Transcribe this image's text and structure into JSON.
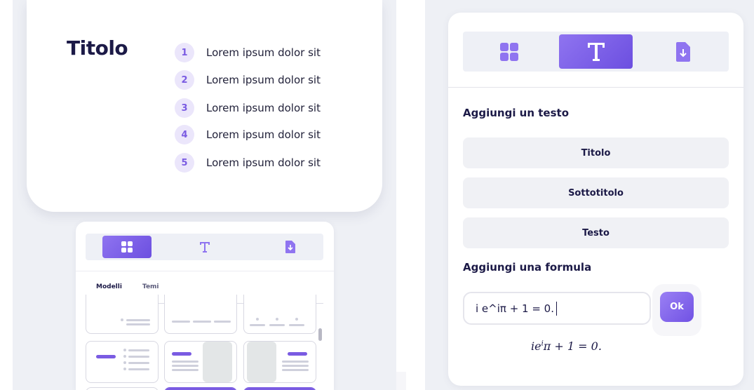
{
  "slide": {
    "title": "Titolo",
    "items": [
      {
        "num": "1",
        "text": "Lorem ipsum dolor sit"
      },
      {
        "num": "2",
        "text": "Lorem ipsum dolor sit"
      },
      {
        "num": "3",
        "text": "Lorem ipsum dolor sit"
      },
      {
        "num": "4",
        "text": "Lorem ipsum dolor sit"
      },
      {
        "num": "5",
        "text": "Lorem ipsum dolor sit"
      }
    ]
  },
  "mini_panel": {
    "tabs": [
      {
        "icon": "grid-icon",
        "active": true
      },
      {
        "icon": "text-icon",
        "active": false
      },
      {
        "icon": "download-icon",
        "active": false
      }
    ],
    "subtabs": [
      "Modelli",
      "Temi"
    ],
    "active_subtab": "Modelli"
  },
  "text_panel": {
    "tabs": [
      {
        "icon": "grid-icon",
        "active": false
      },
      {
        "icon": "text-icon",
        "active": true
      },
      {
        "icon": "download-icon",
        "active": false
      }
    ],
    "add_text_heading": "Aggiungi un testo",
    "buttons": {
      "titolo": "Titolo",
      "sottotitolo": "Sottotitolo",
      "testo": "Testo"
    },
    "add_formula_heading": "Aggiungi una formula",
    "formula_input_value": "i e^iπ + 1 = 0.",
    "ok_label": "Ok",
    "formula_preview": {
      "base": "ie",
      "exponent": "i",
      "rest": "π + 1 = 0."
    }
  },
  "colors": {
    "accent": "#7a5be2",
    "accent_light": "#ebe6fb",
    "title_text": "#1c1a47",
    "panel_bg": "#eef0f5"
  }
}
